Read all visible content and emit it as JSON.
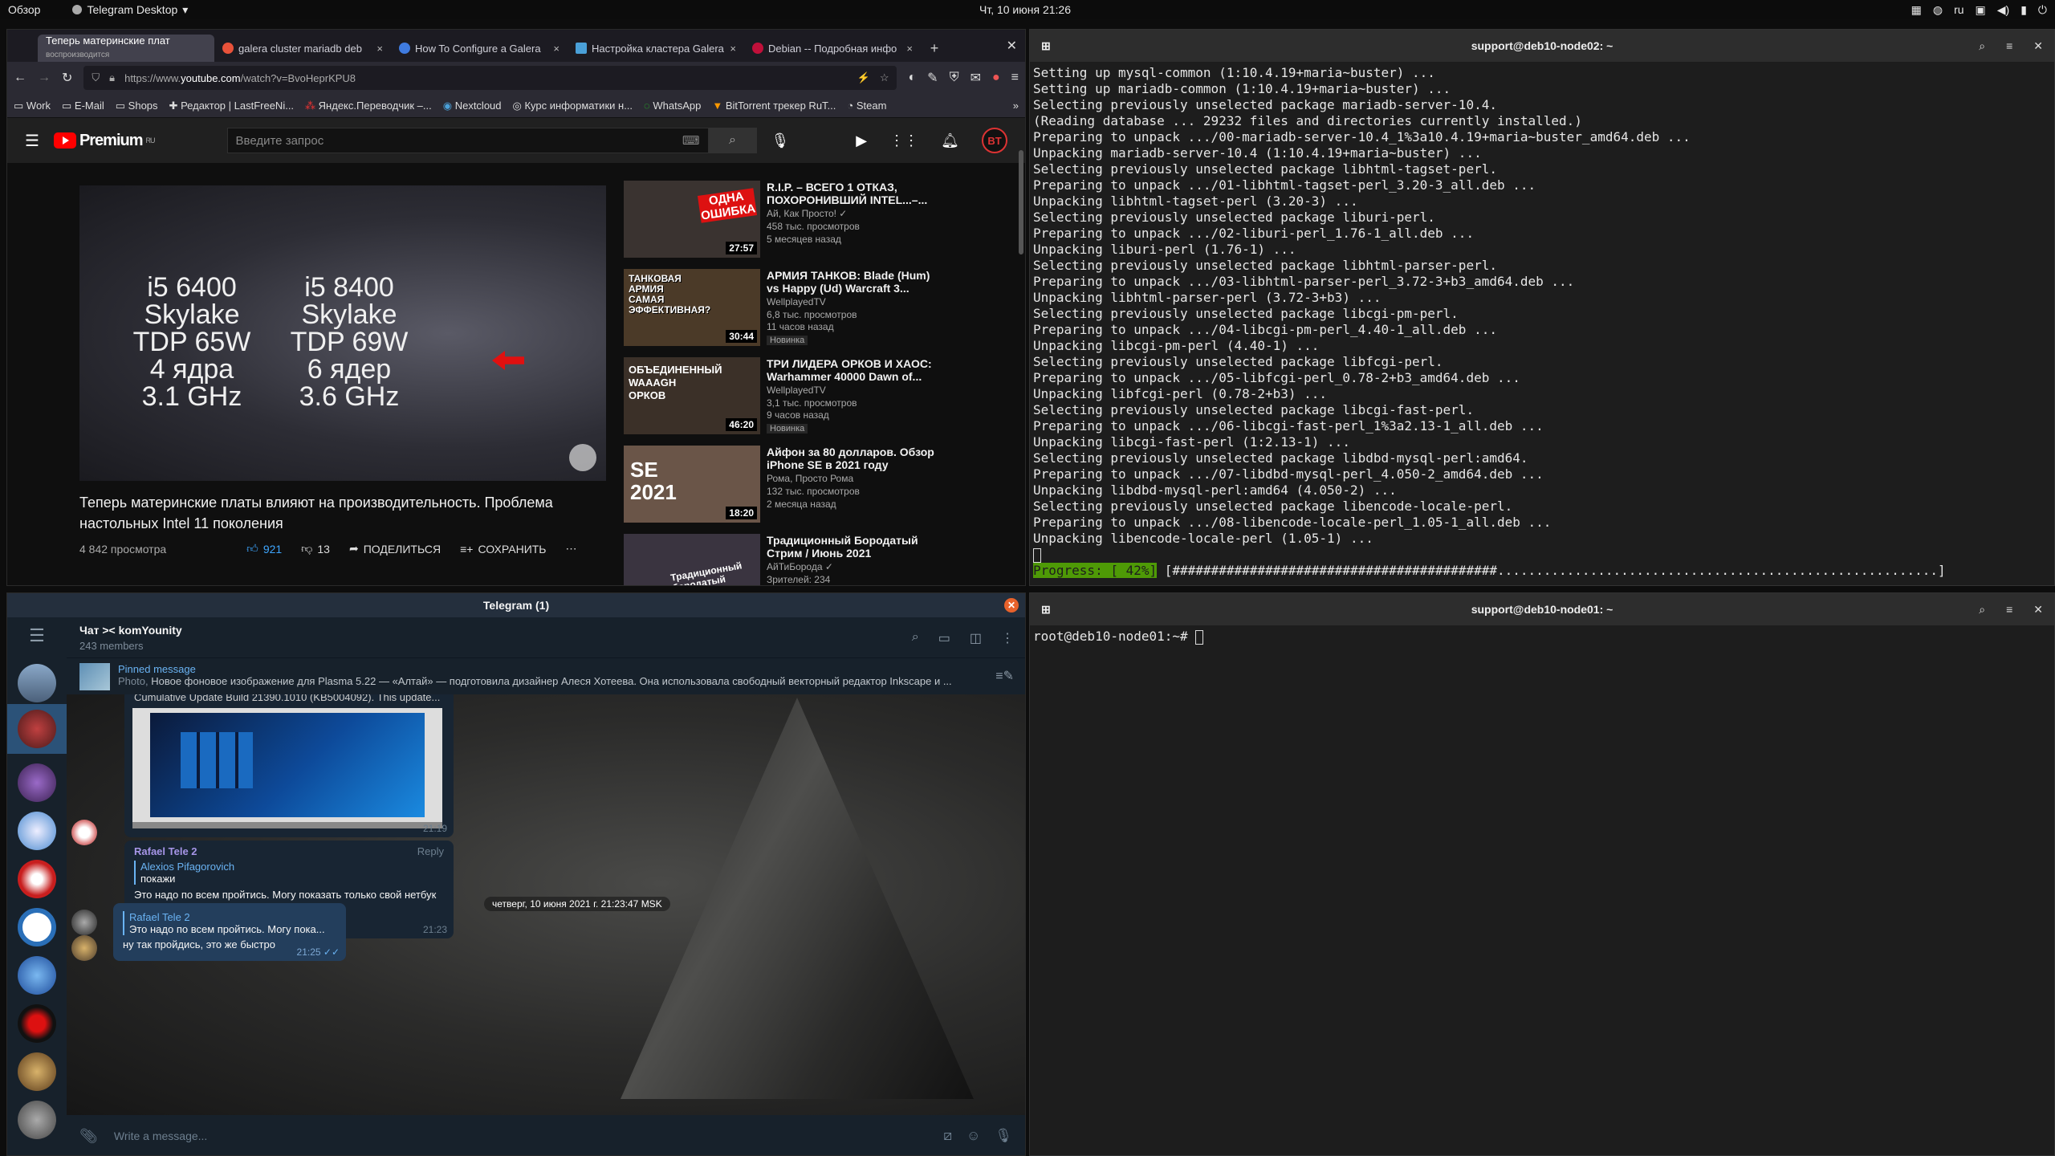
{
  "topbar": {
    "overview": "Обзор",
    "app": "Telegram Desktop",
    "clock": "Чт, 10 июня  21:26",
    "lang": "ru"
  },
  "browser": {
    "tabs": [
      {
        "label": "Теперь материнские плат",
        "sub": "воспроизводится",
        "color": "#ff0000"
      },
      {
        "label": "galera cluster mariadb deb",
        "color": "#e8523a"
      },
      {
        "label": "How To Configure a Galera",
        "color": "#3f7be0"
      },
      {
        "label": "Настройка кластера Galera",
        "color": "#4aa0d8"
      },
      {
        "label": "Debian -- Подробная инфо",
        "color": "#c0103a"
      }
    ],
    "url_prefix": "https://www.",
    "url_host": "youtube.com",
    "url_path": "/watch?v=BvoHeprKPU8",
    "bookmarks": [
      "Work",
      "E-Mail",
      "Shops",
      "Редактор | LastFreeNi...",
      "Яндекс.Переводчик –...",
      "Nextcloud",
      "Курс информатики н...",
      "WhatsApp",
      "BitTorrent трекер RuT...",
      "Steam"
    ]
  },
  "youtube": {
    "logo": "Premium",
    "logo_sup": "RU",
    "search_placeholder": "Введите запрос",
    "avatar": "BT",
    "video_left": [
      "i5 6400",
      "Skylake",
      "TDP 65W",
      "4 ядра",
      "3.1 GHz"
    ],
    "video_right": [
      "i5 8400",
      "Skylake",
      "TDP 69W",
      "6 ядер",
      "3.6 GHz"
    ],
    "title": "Теперь материнские платы влияют на производительность. Проблема настольных Intel 11 поколения",
    "views": "4 842 просмотра",
    "likes": "921",
    "dislikes": "13",
    "share": "ПОДЕЛИТЬСЯ",
    "save": "СОХРАНИТЬ",
    "recommended": [
      {
        "title": "R.I.P. – ВСЕГО 1 ОТКАЗ, ПОХОРОНИВШИЙ INTEL...–...",
        "channel": "Ай, Как Просто! ✓",
        "views": "458 тыс. просмотров",
        "ago": "5 месяцев назад",
        "duration": "27:57",
        "badge": "",
        "thumb_text": "ОДНА ОШИБКА",
        "thumb_bg": "#3a3330"
      },
      {
        "title": "АРМИЯ ТАНКОВ: Blade (Hum) vs Happy (Ud) Warcraft 3...",
        "channel": "WellplayedTV",
        "views": "6,8 тыс. просмотров",
        "ago": "11 часов назад",
        "duration": "30:44",
        "badge": "Новинка",
        "thumb_text": "ТАНКОВАЯ АРМИЯ САМАЯ ЭФФЕКТИВНАЯ?",
        "thumb_bg": "#4b3a28"
      },
      {
        "title": "ТРИ ЛИДЕРА ОРКОВ И ХАОС: Warhammer 40000 Dawn of...",
        "channel": "WellplayedTV",
        "views": "3,1 тыс. просмотров",
        "ago": "9 часов назад",
        "duration": "46:20",
        "badge": "Новинка",
        "thumb_text": "ОБЪЕДИНЕННЫЙ WAAAGH ОРКОВ",
        "thumb_bg": "#3b3028"
      },
      {
        "title": "Айфон за 80 долларов. Обзор iPhone SE в 2021 году",
        "channel": "Рома, Просто Рома",
        "views": "132 тыс. просмотров",
        "ago": "2 месяца назад",
        "duration": "18:20",
        "badge": "",
        "thumb_text": "SE 2021",
        "thumb_bg": "#6a5548"
      },
      {
        "title": "Традиционный Бородатый Стрим / Июнь 2021",
        "channel": "АйТиБорода ✓",
        "views": "Зрителей: 234",
        "ago": "",
        "duration": "",
        "badge": "",
        "thumb_text": "Традиционный бородатый Стрим",
        "thumb_bg": "#3a3440"
      }
    ]
  },
  "term2": {
    "title": "support@deb10-node02: ~",
    "lines": [
      "Setting up mysql-common (1:10.4.19+maria~buster) ...",
      "Setting up mariadb-common (1:10.4.19+maria~buster) ...",
      "Selecting previously unselected package mariadb-server-10.4.",
      "(Reading database ... 29232 files and directories currently installed.)",
      "Preparing to unpack .../00-mariadb-server-10.4_1%3a10.4.19+maria~buster_amd64.deb ...",
      "Unpacking mariadb-server-10.4 (1:10.4.19+maria~buster) ...",
      "Selecting previously unselected package libhtml-tagset-perl.",
      "Preparing to unpack .../01-libhtml-tagset-perl_3.20-3_all.deb ...",
      "Unpacking libhtml-tagset-perl (3.20-3) ...",
      "Selecting previously unselected package liburi-perl.",
      "Preparing to unpack .../02-liburi-perl_1.76-1_all.deb ...",
      "Unpacking liburi-perl (1.76-1) ...",
      "Selecting previously unselected package libhtml-parser-perl.",
      "Preparing to unpack .../03-libhtml-parser-perl_3.72-3+b3_amd64.deb ...",
      "Unpacking libhtml-parser-perl (3.72-3+b3) ...",
      "Selecting previously unselected package libcgi-pm-perl.",
      "Preparing to unpack .../04-libcgi-pm-perl_4.40-1_all.deb ...",
      "Unpacking libcgi-pm-perl (4.40-1) ...",
      "Selecting previously unselected package libfcgi-perl.",
      "Preparing to unpack .../05-libfcgi-perl_0.78-2+b3_amd64.deb ...",
      "Unpacking libfcgi-perl (0.78-2+b3) ...",
      "Selecting previously unselected package libcgi-fast-perl.",
      "Preparing to unpack .../06-libcgi-fast-perl_1%3a2.13-1_all.deb ...",
      "Unpacking libcgi-fast-perl (1:2.13-1) ...",
      "Selecting previously unselected package libdbd-mysql-perl:amd64.",
      "Preparing to unpack .../07-libdbd-mysql-perl_4.050-2_amd64.deb ...",
      "Unpacking libdbd-mysql-perl:amd64 (4.050-2) ...",
      "Selecting previously unselected package libencode-locale-perl.",
      "Preparing to unpack .../08-libencode-locale-perl_1.05-1_all.deb ...",
      "Unpacking libencode-locale-perl (1.05-1) ..."
    ],
    "progress_label": "Progress: [ 42%]",
    "progress_bar": " [##########################################.........................................................] "
  },
  "term1": {
    "title": "support@deb10-node01: ~",
    "prompt": "root@deb10-node01:~# "
  },
  "telegram": {
    "window_title": "Telegram (1)",
    "chat_name": "Чат >< komYounity",
    "members": "243 members",
    "pinned_label": "Pinned message",
    "pinned_prefix": "Photo,",
    "pinned_text": "Новое фоновое изображение для Plasma 5.22 — «Алтай» — подготовила дизайнер Алеся Хотеева. Она использовала свободный векторный редактор Inkscape и ...",
    "msg1_caption": "Cumulative Update Build 21390.1010 (KB5004092). This update...",
    "msg1_time": "21:19",
    "msg2_author": "Rafael Tele 2",
    "msg2_reply": "Reply",
    "msg2_quote_author": "Alexios Pifagorovich",
    "msg2_quote": "покажи",
    "msg2_text": "Это надо по всем пройтись. Могу показать только свой нетбук на Суse.",
    "msg2_time": "21:23",
    "date_pill": "четверг, 10 июня 2021 г. 21:23:47 MSK",
    "msg3_quote_author": "Rafael Tele 2",
    "msg3_quote": "Это надо по всем пройтись. Могу пока...",
    "msg3_text": "ну так пройдись, это же быстро",
    "msg3_time": "21:25",
    "input_placeholder": "Write a message..."
  }
}
